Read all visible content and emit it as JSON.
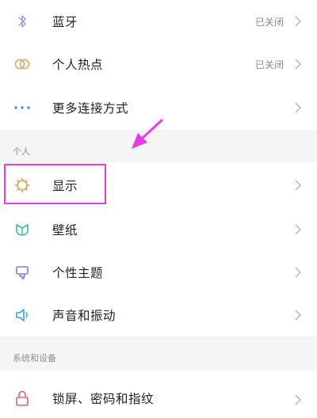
{
  "connectivity": {
    "items": [
      {
        "label": "蓝牙",
        "status": "已关闭",
        "icon": "bluetooth-icon"
      },
      {
        "label": "个人热点",
        "status": "已关闭",
        "icon": "hotspot-icon"
      },
      {
        "label": "更多连接方式",
        "status": "",
        "icon": "more-dots-icon"
      }
    ]
  },
  "personal": {
    "title": "个人",
    "items": [
      {
        "label": "显示",
        "icon": "display-icon"
      },
      {
        "label": "壁纸",
        "icon": "wallpaper-icon"
      },
      {
        "label": "个性主题",
        "icon": "theme-icon"
      },
      {
        "label": "声音和振动",
        "icon": "sound-icon"
      }
    ]
  },
  "system": {
    "title": "系统和设备",
    "items": [
      {
        "label": "锁屏、密码和指纹",
        "icon": "lock-icon"
      }
    ]
  },
  "colors": {
    "highlight": "#e43fe4",
    "arrow": "#e63ce6"
  }
}
